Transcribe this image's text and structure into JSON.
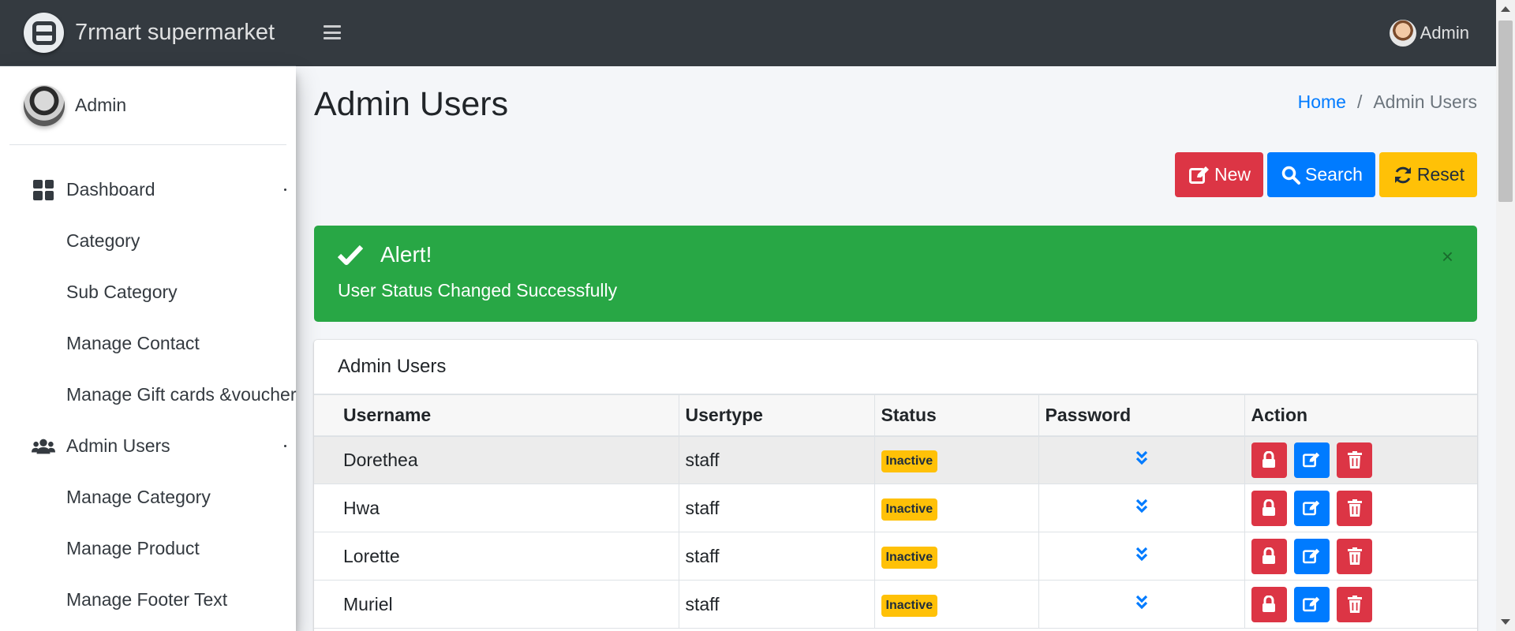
{
  "brand": {
    "name": "7rmart supermarket"
  },
  "topbar": {
    "user_name": "Admin"
  },
  "sidebar": {
    "user_name": "Admin",
    "items": [
      {
        "label": "Dashboard",
        "icon": "dashboard-grid-icon"
      },
      {
        "label": "Category"
      },
      {
        "label": "Sub Category"
      },
      {
        "label": "Manage Contact"
      },
      {
        "label": "Manage Gift cards &voucher"
      },
      {
        "label": "Admin Users",
        "icon": "users-icon"
      },
      {
        "label": "Manage Category"
      },
      {
        "label": "Manage Product"
      },
      {
        "label": "Manage Footer Text"
      }
    ]
  },
  "page": {
    "title": "Admin Users"
  },
  "breadcrumb": {
    "home": "Home",
    "separator": "/",
    "current": "Admin Users"
  },
  "toolbar": {
    "new_label": "New",
    "search_label": "Search",
    "reset_label": "Reset"
  },
  "alert": {
    "title": "Alert!",
    "message": "User Status Changed Successfully",
    "close": "×"
  },
  "card": {
    "title": "Admin Users"
  },
  "table": {
    "headers": [
      "Username",
      "Usertype",
      "Status",
      "Password",
      "Action"
    ],
    "rows": [
      {
        "username": "Dorethea",
        "usertype": "staff",
        "status": "Inactive"
      },
      {
        "username": "Hwa",
        "usertype": "staff",
        "status": "Inactive"
      },
      {
        "username": "Lorette",
        "usertype": "staff",
        "status": "Inactive"
      },
      {
        "username": "Muriel",
        "usertype": "staff",
        "status": "Inactive"
      }
    ]
  },
  "colors": {
    "navbar": "#343a40",
    "success": "#28a745",
    "danger": "#dc3545",
    "primary": "#007bff",
    "warning": "#ffc107"
  }
}
